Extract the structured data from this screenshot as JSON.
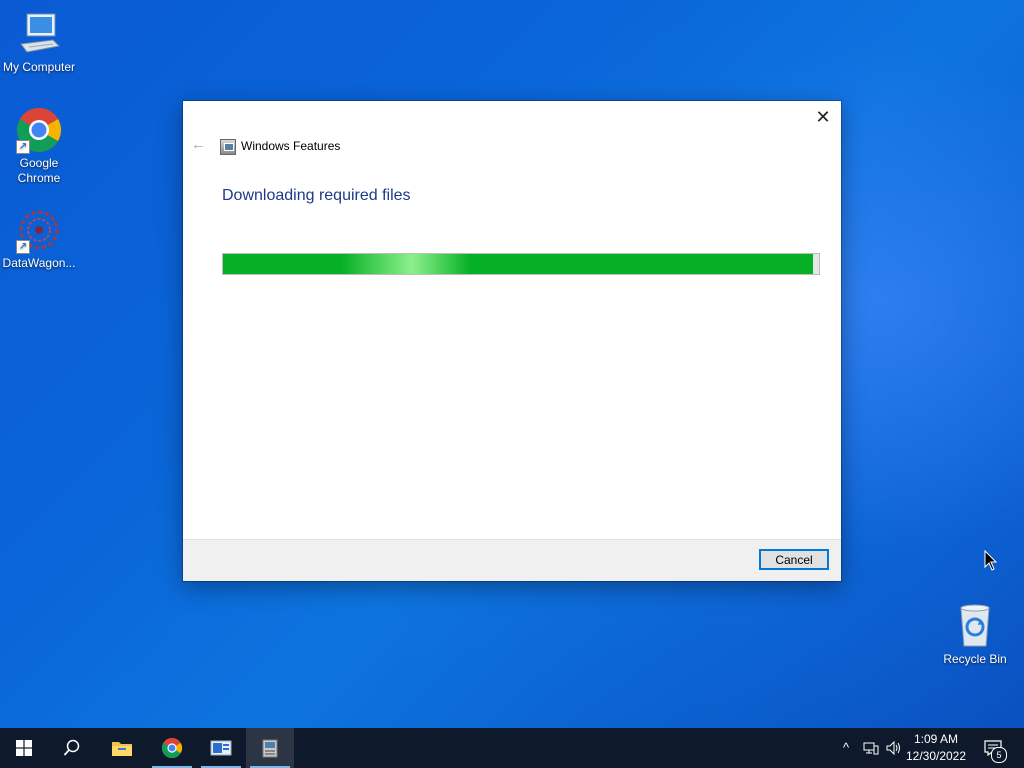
{
  "desktop": {
    "icons": [
      {
        "label": "My Computer"
      },
      {
        "label": "Google Chrome"
      },
      {
        "label": "DataWagon..."
      },
      {
        "label": "Recycle Bin"
      }
    ]
  },
  "dialog": {
    "title": "Windows Features",
    "heading": "Downloading required files",
    "progress_percent": 99,
    "cancel_label": "Cancel",
    "close_glyph": "✕",
    "back_glyph": "←"
  },
  "taskbar": {
    "apps": [
      {
        "icon": "windows-start-icon"
      },
      {
        "icon": "search-icon"
      },
      {
        "icon": "file-explorer-icon"
      },
      {
        "icon": "chrome-icon"
      },
      {
        "icon": "server-manager-icon"
      },
      {
        "icon": "windows-features-icon"
      }
    ],
    "clock_time": "1:09 AM",
    "clock_date": "12/30/2022",
    "notification_count": "5"
  },
  "colors": {
    "progress": "#06b025",
    "accent": "#0078d7",
    "heading": "#1e3a8a"
  }
}
